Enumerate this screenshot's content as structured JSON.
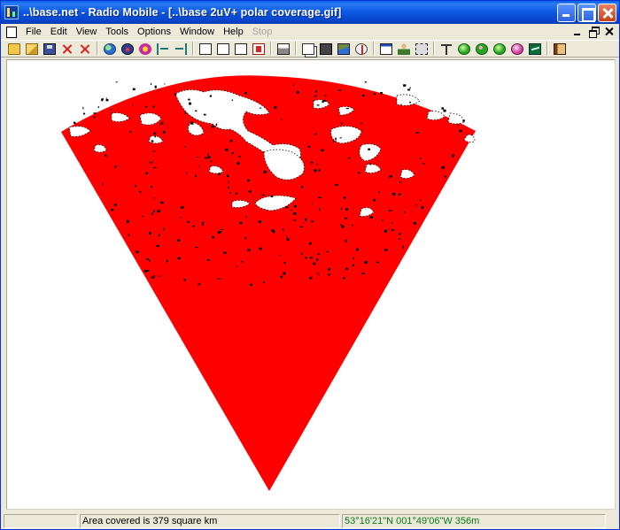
{
  "window": {
    "title": "..\\base.net - Radio Mobile - [..\\base 2uV+ polar coverage.gif]"
  },
  "menu": {
    "items": [
      {
        "label": "File",
        "enabled": true
      },
      {
        "label": "Edit",
        "enabled": true
      },
      {
        "label": "View",
        "enabled": true
      },
      {
        "label": "Tools",
        "enabled": true
      },
      {
        "label": "Options",
        "enabled": true
      },
      {
        "label": "Window",
        "enabled": true
      },
      {
        "label": "Help",
        "enabled": true
      },
      {
        "label": "Stop",
        "enabled": false
      }
    ]
  },
  "toolbar": {
    "groups": [
      [
        "new-network-icon",
        "open-network-icon",
        "save-network-icon",
        "close-network-icon",
        "add-unit-icon"
      ],
      [
        "globe-icon",
        "merge-pictures-icon",
        "coverage-icon",
        "arrow-left-icon",
        "arrow-right-icon"
      ],
      [
        "new-picture-icon",
        "open-picture-icon",
        "copy-picture-icon",
        "export-picture-icon"
      ],
      [
        "print-icon"
      ],
      [
        "copy-icon",
        "paste-stack-icon",
        "terrain-icon",
        "compass-icon"
      ],
      [
        "window-icon",
        "person-icon",
        "frame-icon"
      ],
      [
        "antenna-icon",
        "radio-link-icon",
        "coverage-ball-icon",
        "interference-icon",
        "star-icon",
        "elevation-chart-icon"
      ],
      [
        "book-icon"
      ]
    ]
  },
  "colors": {
    "coverage": "#ff0000",
    "obstruction": "#000000",
    "gap": "#ffffff"
  },
  "statusbar": {
    "area_covered": "Area covered is 379 square km",
    "coordinates": "53°16'21\"N 001°49'06\"W 356m"
  }
}
